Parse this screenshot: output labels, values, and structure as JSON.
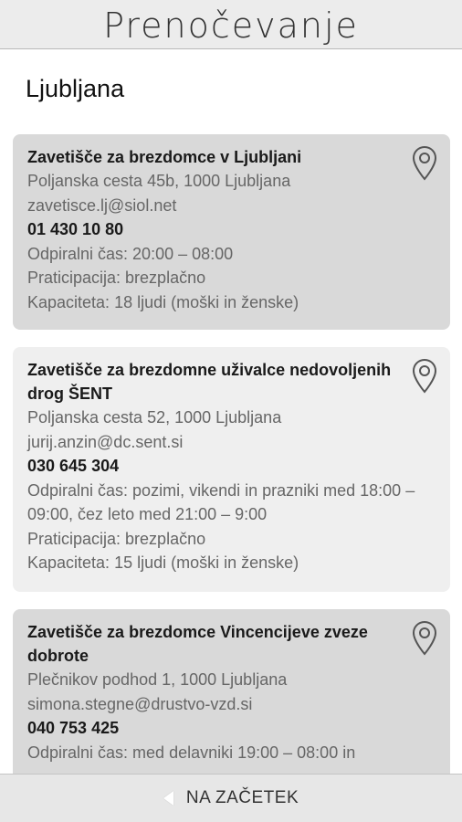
{
  "header": {
    "title": "Prenočevanje"
  },
  "section": {
    "title": "Ljubljana"
  },
  "shelters": [
    {
      "name": "Zavetišče za brezdomce v Ljubljani",
      "address": "Poljanska cesta 45b, 1000 Ljubljana",
      "email": "zavetisce.lj@siol.net",
      "phone": "01 430 10 80",
      "hours": "Odpiralni čas: 20:00 – 08:00",
      "participation": "Praticipacija: brezplačno",
      "capacity": "Kapaciteta: 18 ljudi (moški in ženske)"
    },
    {
      "name": "Zavetišče za brezdomne uživalce nedovoljenih drog ŠENT",
      "address": "Poljanska cesta 52, 1000 Ljubljana",
      "email": "jurij.anzin@dc.sent.si",
      "phone": "030 645 304",
      "hours": "Odpiralni čas: pozimi, vikendi in prazniki med 18:00 – 09:00, čez leto med 21:00 – 9:00",
      "participation": "Praticipacija: brezplačno",
      "capacity": "Kapaciteta: 15 ljudi (moški in ženske)"
    },
    {
      "name": "Zavetišče za brezdomce Vincencijeve zveze dobrote",
      "address": "Plečnikov podhod 1, 1000 Ljubljana",
      "email": "simona.stegne@drustvo-vzd.si",
      "phone": "040 753 425",
      "hours": "Odpiralni čas: med delavniki 19:00 – 08:00 in"
    }
  ],
  "icons": {
    "location": "map-pin-icon",
    "back": "back-arrow-icon"
  },
  "footer": {
    "back_label": "NA ZAČETEK"
  }
}
